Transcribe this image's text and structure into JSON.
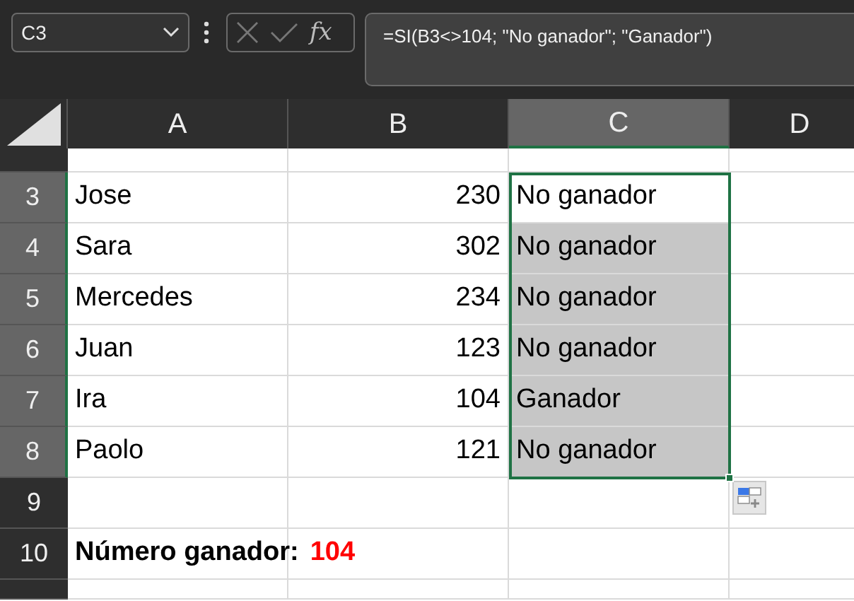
{
  "name_box": {
    "value": "C3"
  },
  "formula_bar": {
    "edit_disabled": true,
    "function_label": "fx",
    "formula": "=SI(B3<>104; \"No ganador\"; \"Ganador\")"
  },
  "columns": [
    {
      "label": "A",
      "selected": false
    },
    {
      "label": "B",
      "selected": false
    },
    {
      "label": "C",
      "selected": true
    },
    {
      "label": "D",
      "selected": false
    }
  ],
  "rows": [
    {
      "selected": false,
      "cells": [
        {
          "kind": "empty"
        },
        {
          "kind": "empty"
        },
        {
          "kind": "empty"
        },
        {
          "kind": "empty"
        }
      ]
    },
    {
      "label": "3",
      "selected": true,
      "cells": [
        {
          "kind": "text",
          "text": "Jose"
        },
        {
          "kind": "number",
          "text": "230"
        },
        {
          "kind": "text",
          "text": "No ganador",
          "selected": true,
          "active": true
        },
        {
          "kind": "empty"
        }
      ]
    },
    {
      "label": "4",
      "selected": true,
      "cells": [
        {
          "kind": "text",
          "text": "Sara"
        },
        {
          "kind": "number",
          "text": "302"
        },
        {
          "kind": "text",
          "text": "No ganador",
          "selected": true,
          "active": false
        },
        {
          "kind": "empty"
        }
      ]
    },
    {
      "label": "5",
      "selected": true,
      "cells": [
        {
          "kind": "text",
          "text": "Mercedes"
        },
        {
          "kind": "number",
          "text": "234"
        },
        {
          "kind": "text",
          "text": "No ganador",
          "selected": true,
          "active": false
        },
        {
          "kind": "empty"
        }
      ]
    },
    {
      "label": "6",
      "selected": true,
      "cells": [
        {
          "kind": "text",
          "text": "Juan"
        },
        {
          "kind": "number",
          "text": "123"
        },
        {
          "kind": "text",
          "text": "No ganador",
          "selected": true,
          "active": false
        },
        {
          "kind": "empty"
        }
      ]
    },
    {
      "label": "7",
      "selected": true,
      "cells": [
        {
          "kind": "text",
          "text": "Ira"
        },
        {
          "kind": "number",
          "text": "104"
        },
        {
          "kind": "text",
          "text": "Ganador",
          "selected": true,
          "active": false
        },
        {
          "kind": "empty"
        }
      ]
    },
    {
      "label": "8",
      "selected": true,
      "cells": [
        {
          "kind": "text",
          "text": "Paolo"
        },
        {
          "kind": "number",
          "text": "121"
        },
        {
          "kind": "text",
          "text": "No ganador",
          "selected": true,
          "active": false
        },
        {
          "kind": "empty"
        }
      ]
    },
    {
      "label": "9",
      "selected": false,
      "cells": [
        {
          "kind": "empty"
        },
        {
          "kind": "empty"
        },
        {
          "kind": "empty"
        },
        {
          "kind": "empty"
        }
      ]
    },
    {
      "label": "10",
      "selected": false,
      "cells": [
        {
          "kind": "result",
          "text": "Número ganador:",
          "value": "104"
        },
        {
          "kind": "empty"
        },
        {
          "kind": "empty"
        },
        {
          "kind": "empty"
        }
      ]
    },
    {
      "selected": false,
      "cells": [
        {
          "kind": "empty"
        },
        {
          "kind": "empty"
        },
        {
          "kind": "empty"
        },
        {
          "kind": "empty"
        }
      ]
    }
  ]
}
